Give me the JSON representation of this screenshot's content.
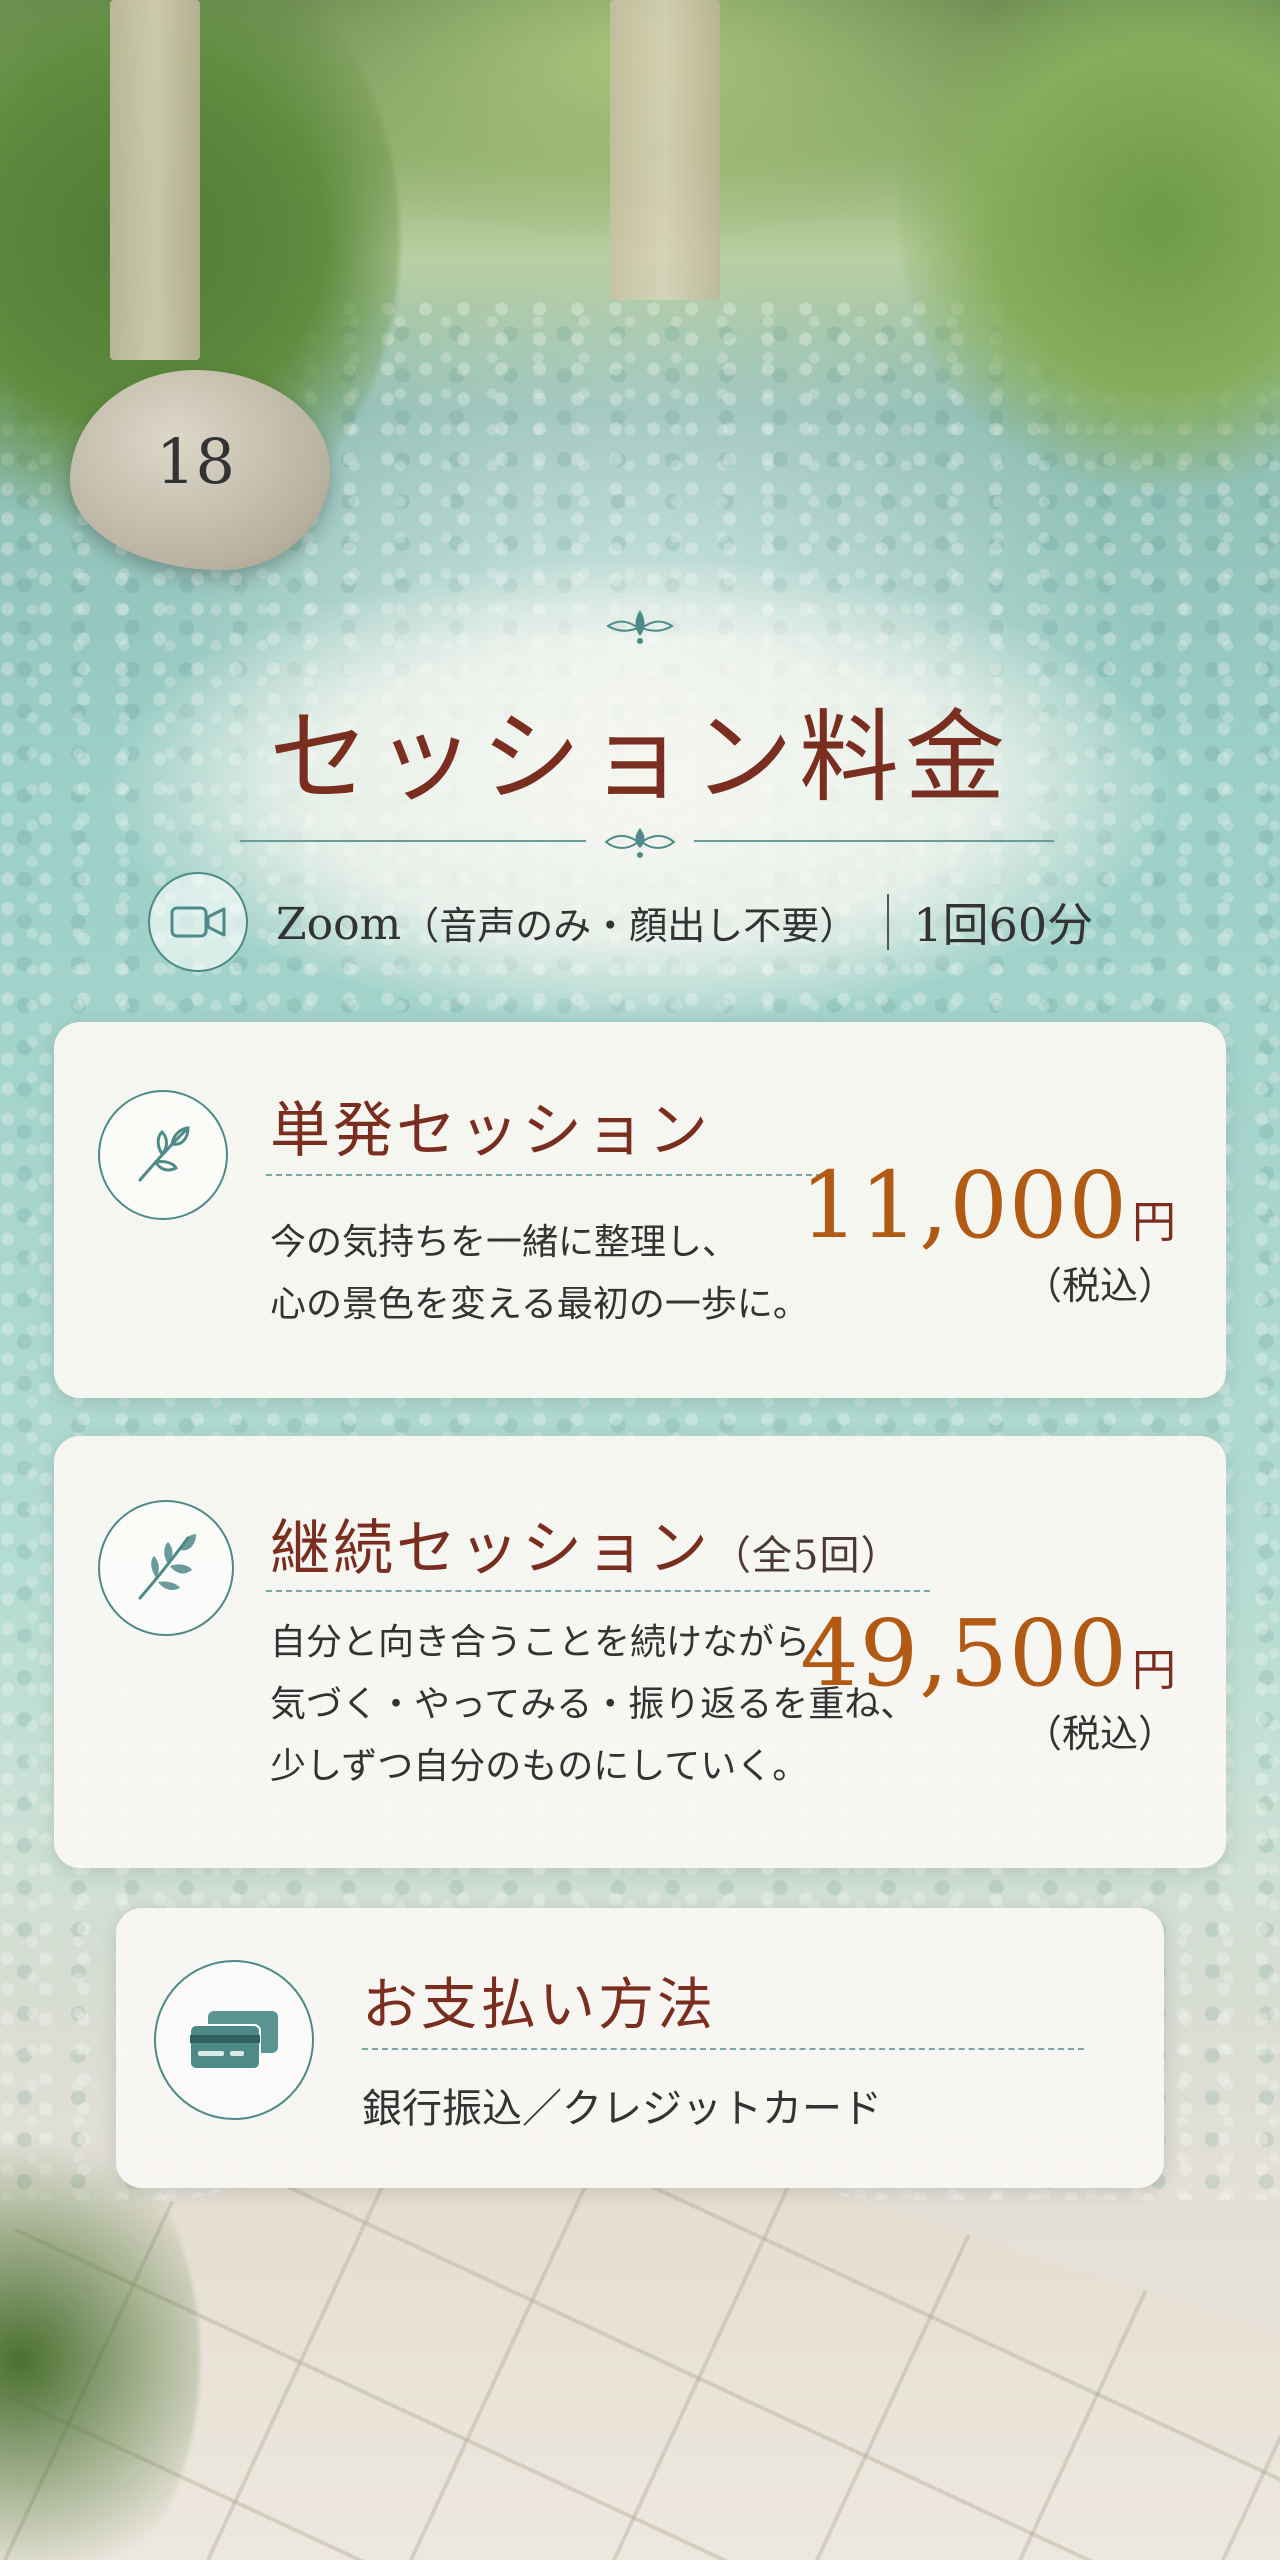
{
  "background": {
    "stone_number": "18"
  },
  "header": {
    "title": "セッション料金",
    "zoom_label": "Zoom",
    "zoom_note": "（音声のみ・顔出し不要）",
    "duration": "1回60分",
    "icon": "video-camera-icon"
  },
  "plans": [
    {
      "title": "単発セッション",
      "title_note": "",
      "description": [
        "今の気持ちを一緒に整理し、",
        "心の景色を変える最初の一歩に。"
      ],
      "price": "11,000",
      "currency": "円",
      "tax_note": "（税込）",
      "icon": "leaf-sprig-icon"
    },
    {
      "title": "継続セッション",
      "title_note": "（全5回）",
      "description": [
        "自分と向き合うことを続けながら、",
        "気づく・やってみる・振り返るを重ね、",
        "少しずつ自分のものにしていく。"
      ],
      "price": "49,500",
      "currency": "円",
      "tax_note": "（税込）",
      "icon": "branch-icon"
    }
  ],
  "payment": {
    "title": "お支払い方法",
    "methods": "銀行振込／クレジットカード",
    "icon": "credit-cards-icon"
  },
  "colors": {
    "title": "#7a2e20",
    "price": "#b05a14",
    "accent": "#4e8a88",
    "card": "#f9f7f2"
  }
}
